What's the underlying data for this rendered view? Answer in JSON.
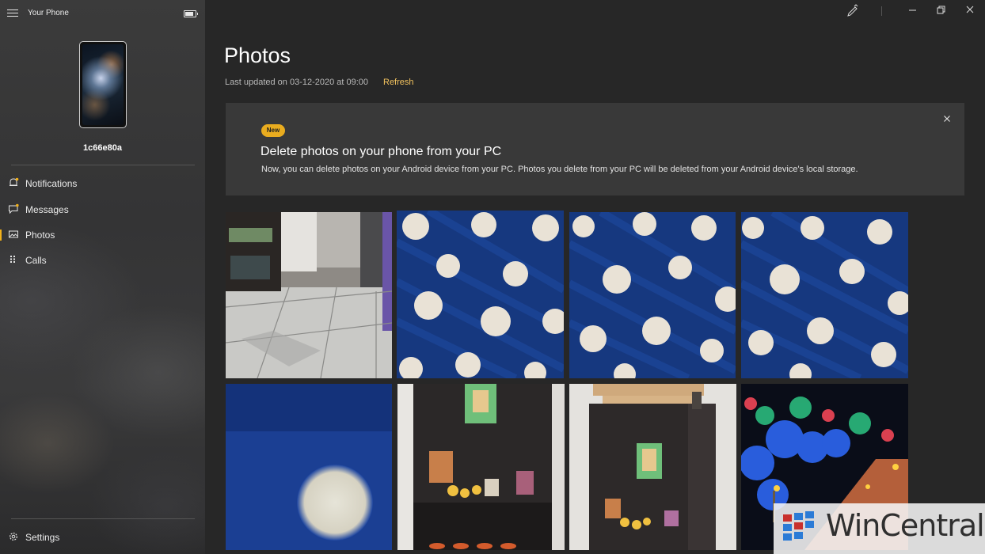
{
  "app": {
    "title": "Your Phone"
  },
  "device": {
    "name": "1c66e80a"
  },
  "nav": {
    "items": [
      {
        "label": "Notifications",
        "icon": "bell-icon",
        "active": false
      },
      {
        "label": "Messages",
        "icon": "message-icon",
        "active": false
      },
      {
        "label": "Photos",
        "icon": "photo-icon",
        "active": true
      },
      {
        "label": "Calls",
        "icon": "dialpad-icon",
        "active": false
      }
    ],
    "settings_label": "Settings"
  },
  "page": {
    "title": "Photos",
    "last_updated": "Last updated on 03-12-2020 at 09:00",
    "refresh_label": "Refresh"
  },
  "banner": {
    "badge": "New",
    "title": "Delete photos on your phone from your PC",
    "text": "Now, you can delete photos on your Android device from your PC. Photos you delete from your PC will be deleted from your Android device's local storage."
  },
  "photos": [
    {
      "subject": "room-floor"
    },
    {
      "subject": "polka-dot-fabric"
    },
    {
      "subject": "polka-dot-fabric"
    },
    {
      "subject": "polka-dot-fabric"
    },
    {
      "subject": "blurred-dot-closeup"
    },
    {
      "subject": "shrine-cabinet"
    },
    {
      "subject": "shrine-cabinet-open"
    },
    {
      "subject": "night-lights"
    }
  ],
  "watermark": {
    "text": "WinCentral"
  },
  "colors": {
    "accent": "#f2b11a",
    "background": "#272727",
    "banner": "#393939",
    "link": "#f2c25e"
  }
}
